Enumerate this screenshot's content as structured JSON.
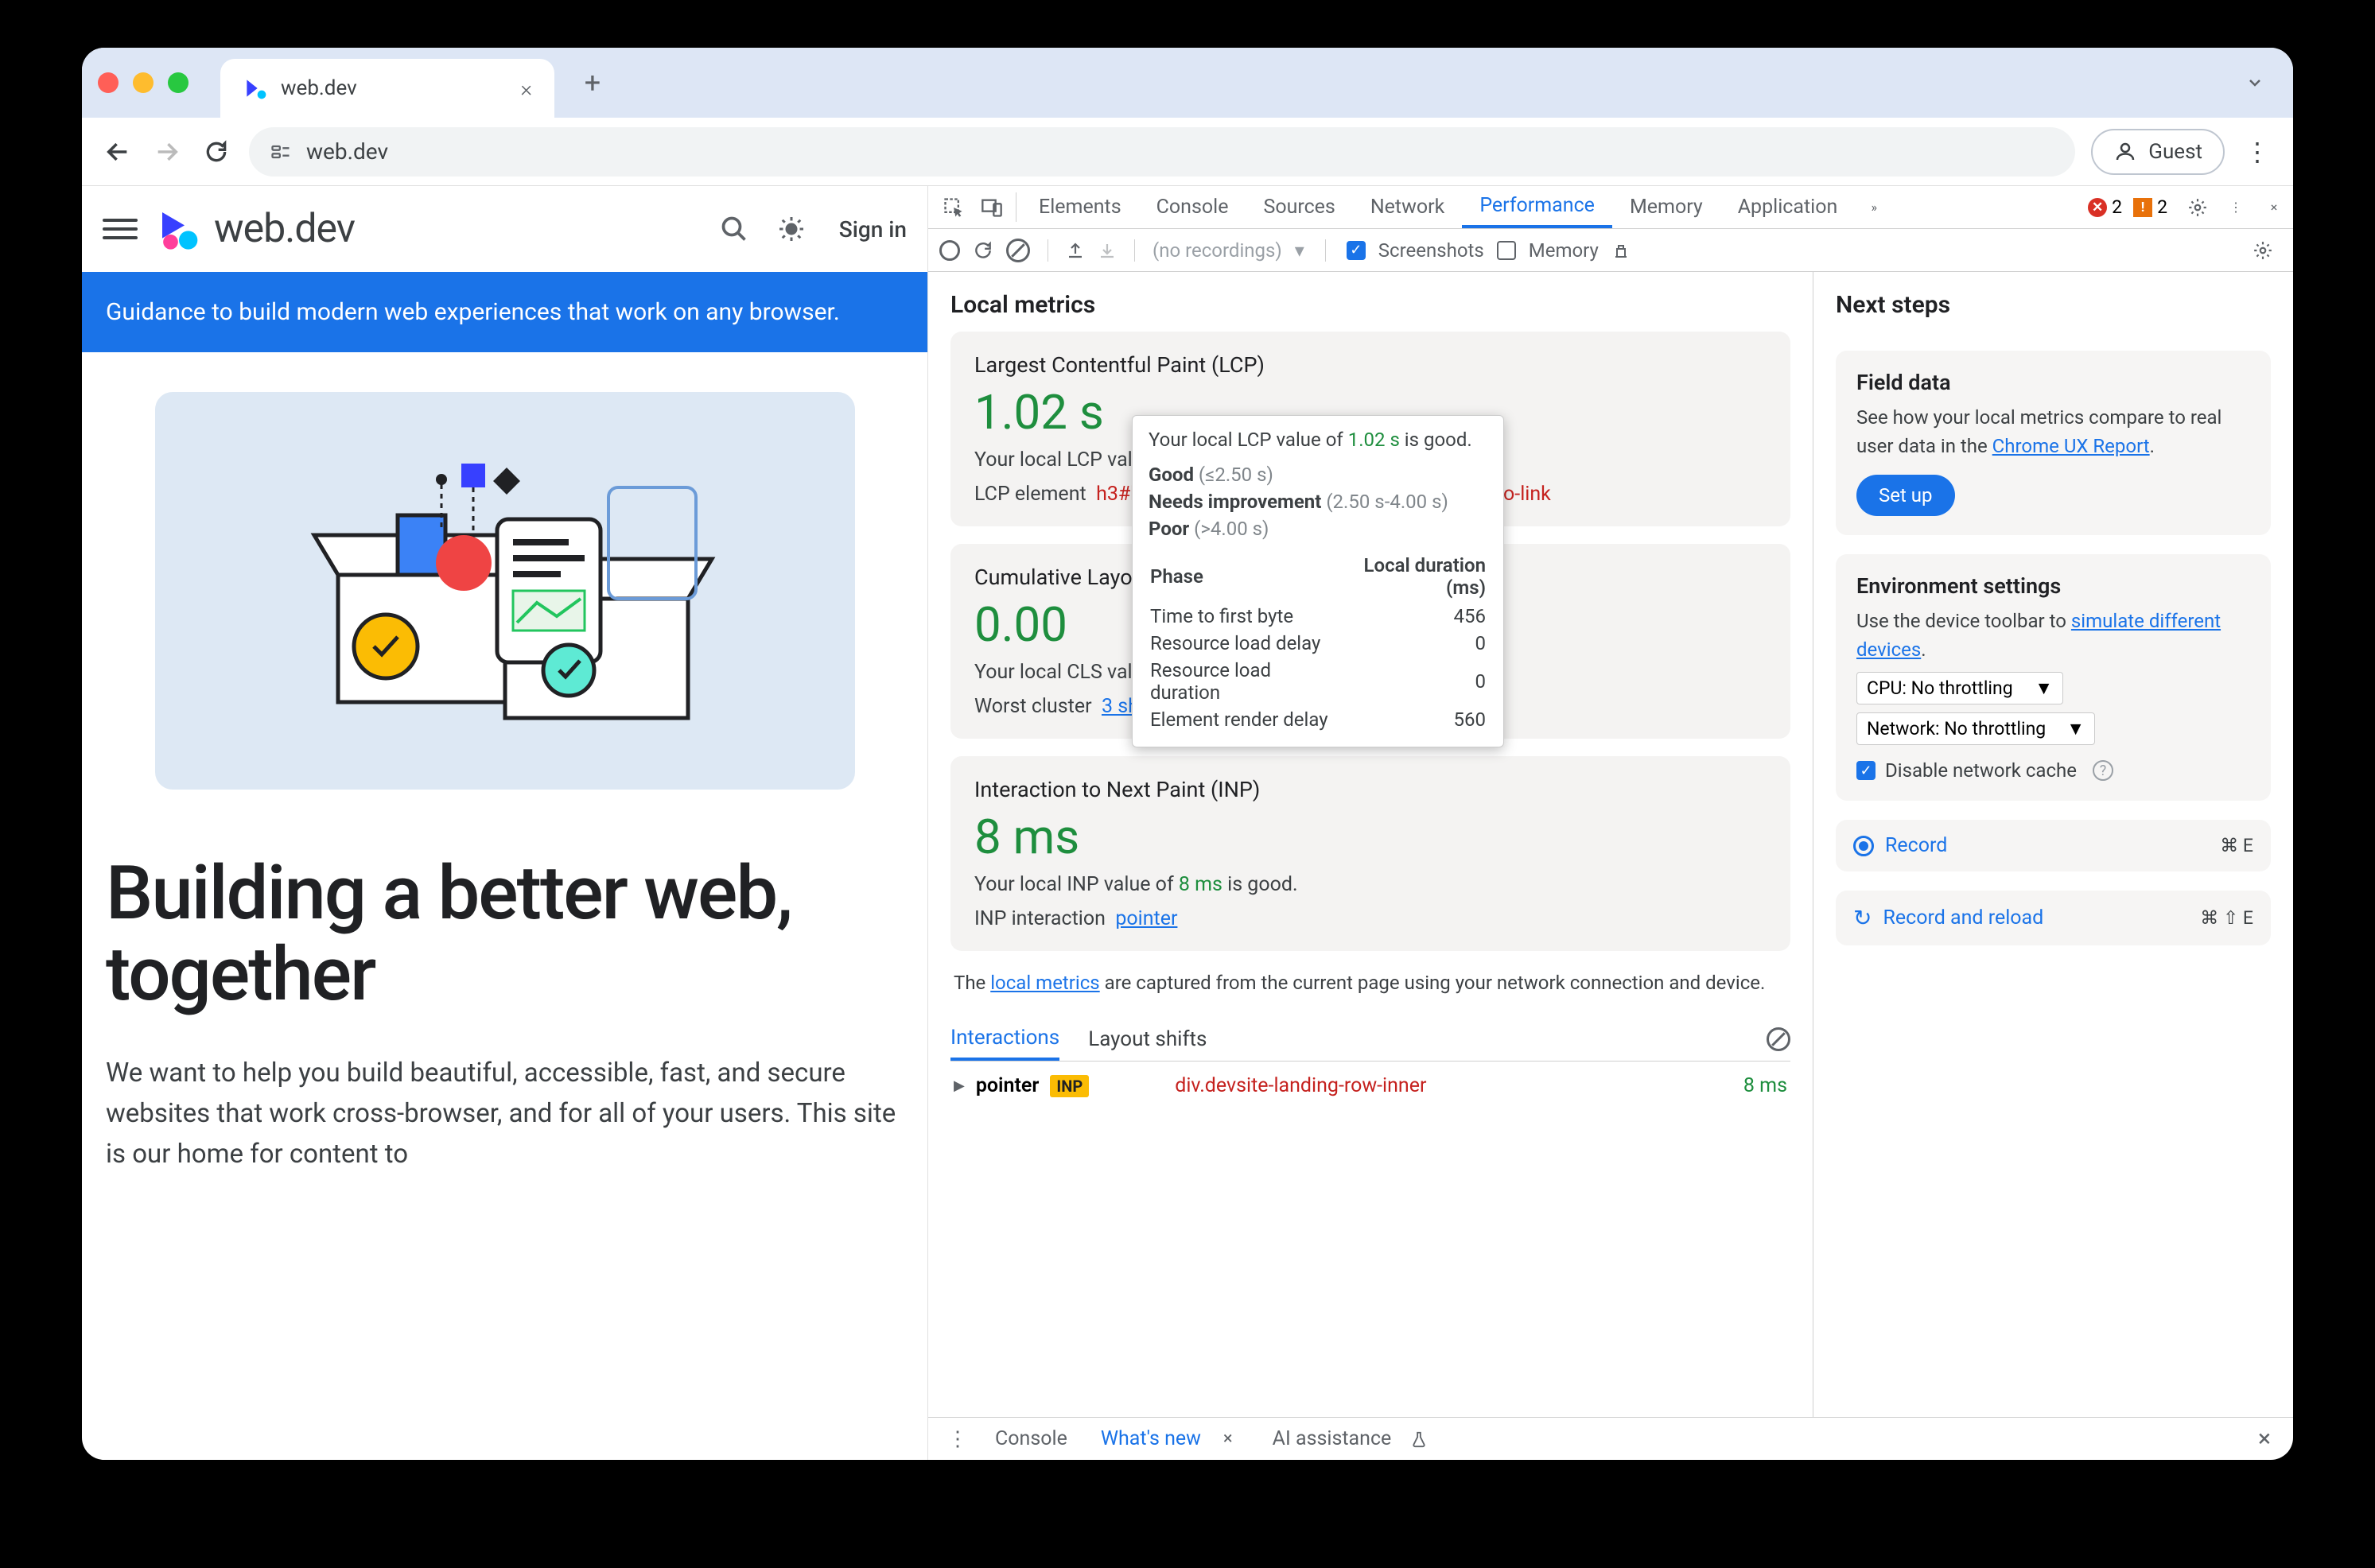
{
  "browser": {
    "tab_title": "web.dev",
    "address": "web.dev",
    "guest_label": "Guest"
  },
  "site": {
    "logo_text": "web.dev",
    "signin": "Sign in",
    "banner": "Guidance to build modern web experiences that work on any browser.",
    "hero_title": "Building a better web, together",
    "hero_body": "We want to help you build beautiful, accessible, fast, and secure websites that work cross-browser, and for all of your users. This site is our home for content to"
  },
  "devtools": {
    "tabs": [
      "Elements",
      "Console",
      "Sources",
      "Network",
      "Performance",
      "Memory",
      "Application"
    ],
    "active_tab": "Performance",
    "err_count": "2",
    "warn_count": "2",
    "toolbar": {
      "no_recordings": "(no recordings)",
      "screenshots": "Screenshots",
      "memory": "Memory"
    },
    "local_metrics_title": "Local metrics",
    "lcp": {
      "title": "Largest Contentful Paint (LCP)",
      "value": "1.02 s",
      "desc_prefix": "Your local LCP valu",
      "element_label": "LCP element",
      "element_selector": "h3#b",
      "element_suffix": ".toc.no-link"
    },
    "cls": {
      "title": "Cumulative Layo",
      "value": "0.00",
      "desc_prefix": "Your local CLS valu",
      "worst_label": "Worst cluster",
      "worst_link": "3 shifts"
    },
    "inp": {
      "title": "Interaction to Next Paint (INP)",
      "value": "8 ms",
      "desc_prefix": "Your local INP value of",
      "desc_value": "8 ms",
      "desc_suffix": "is good.",
      "interaction_label": "INP interaction",
      "interaction_link": "pointer"
    },
    "tooltip": {
      "line1_pre": "Your local LCP value of",
      "line1_val": "1.02 s",
      "line1_post": "is good.",
      "good": "Good",
      "good_range": "(≤2.50 s)",
      "ni": "Needs improvement",
      "ni_range": "(2.50 s-4.00 s)",
      "poor": "Poor",
      "poor_range": "(>4.00 s)",
      "phase": "Phase",
      "duration": "Local duration (ms)",
      "rows": [
        {
          "label": "Time to first byte",
          "ms": "456"
        },
        {
          "label": "Resource load delay",
          "ms": "0"
        },
        {
          "label": "Resource load duration",
          "ms": "0"
        },
        {
          "label": "Element render delay",
          "ms": "560"
        }
      ]
    },
    "caption_pre": "The",
    "caption_link": "local metrics",
    "caption_post": "are captured from the current page using your network connection and device.",
    "subtabs": {
      "interactions": "Interactions",
      "layout_shifts": "Layout shifts"
    },
    "interaction_row": {
      "type": "pointer",
      "badge": "INP",
      "target": "div.devsite-landing-row-inner",
      "time": "8 ms"
    },
    "next_steps_title": "Next steps",
    "field": {
      "title": "Field data",
      "body_pre": "See how your local metrics compare to real user data in the",
      "body_link": "Chrome UX Report",
      "setup": "Set up"
    },
    "env": {
      "title": "Environment settings",
      "body_pre": "Use the device toolbar to",
      "body_link": "simulate different devices",
      "cpu": "CPU: No throttling",
      "net": "Network: No throttling",
      "disable_cache": "Disable network cache"
    },
    "record": {
      "label": "Record",
      "kbd": "⌘ E"
    },
    "record_reload": {
      "label": "Record and reload",
      "kbd": "⌘ ⇧ E"
    },
    "drawer": {
      "items": [
        "Console",
        "What's new",
        "AI assistance"
      ],
      "active": "What's new"
    }
  }
}
